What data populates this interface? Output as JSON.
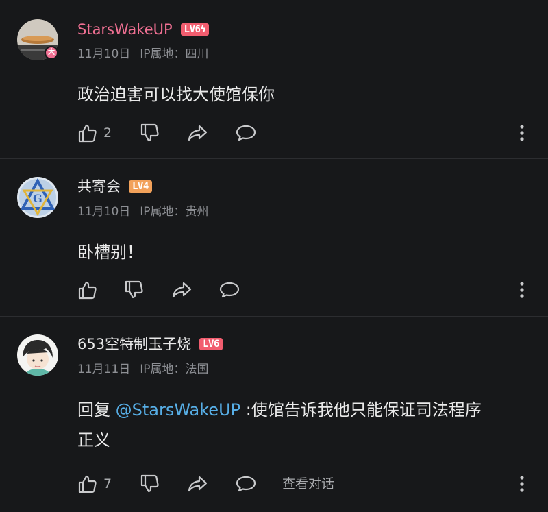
{
  "comments": [
    {
      "username": "StarsWakeUP",
      "level": "LV6",
      "level_mark": "ϟ",
      "avatar_badge": "大",
      "date": "11月10日",
      "ip_location": "IP属地：四川",
      "content": "政治迫害可以找大使馆保你",
      "like_count": "2",
      "icons": [
        "thumb-up-icon",
        "thumb-down-icon",
        "share-icon",
        "reply-icon",
        "more-vert-icon"
      ]
    },
    {
      "username": "共寄会",
      "level": "LV4",
      "date": "11月10日",
      "ip_location": "IP属地：贵州",
      "content": "卧槽别！",
      "like_count": "",
      "icons": [
        "thumb-up-icon",
        "thumb-down-icon",
        "share-icon",
        "reply-icon",
        "more-vert-icon"
      ]
    },
    {
      "username": "653空特制玉子烧",
      "level": "LV6",
      "date": "11月11日",
      "ip_location": "IP属地：法国",
      "content_prefix": "回复 ",
      "mention": "@StarsWakeUP",
      "content_line1": " :使馆告诉我他只能保证司法程序",
      "content_line2": "正义",
      "like_count": "7",
      "view_conversation": "查看对话",
      "icons": [
        "thumb-up-icon",
        "thumb-down-icon",
        "share-icon",
        "reply-icon",
        "more-vert-icon"
      ]
    }
  ],
  "colors": {
    "background": "#17181a",
    "vip_name": "#f07093",
    "mention": "#57aee6",
    "meta": "#8d8f94",
    "level6": "#f25d6f",
    "level4": "#f2a15a"
  }
}
